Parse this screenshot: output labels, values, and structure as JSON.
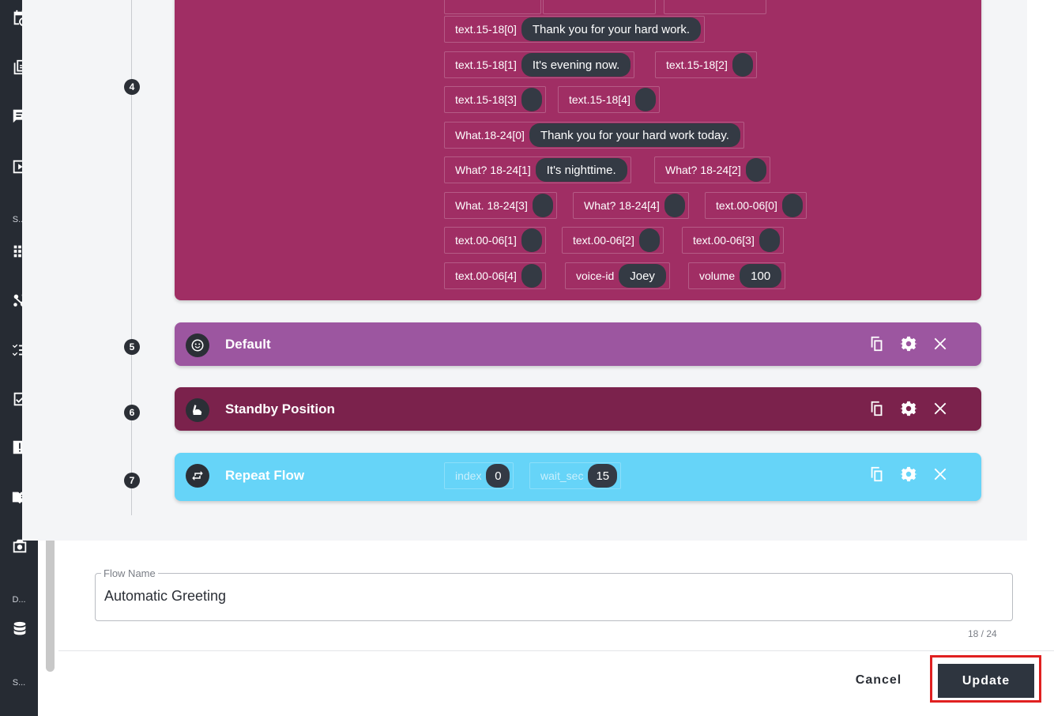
{
  "nav": {
    "label_s1": "S...",
    "label_d": "D...",
    "label_s2": "S..."
  },
  "steps": [
    "4",
    "5",
    "6",
    "7"
  ],
  "speech_block": {
    "color": "#a02e64",
    "params": [
      {
        "key": "text.15-18[0]",
        "value": "Thank you for your hard work."
      },
      {
        "key": "text.15-18[1]",
        "value": "It's evening now."
      },
      {
        "key": "text.15-18[2]",
        "value": ""
      },
      {
        "key": "text.15-18[3]",
        "value": ""
      },
      {
        "key": "text.15-18[4]",
        "value": ""
      },
      {
        "key": "What.18-24[0]",
        "value": "Thank you for your hard work today."
      },
      {
        "key": "What? 18-24[1]",
        "value": "It's nighttime."
      },
      {
        "key": "What? 18-24[2]",
        "value": ""
      },
      {
        "key": "What. 18-24[3]",
        "value": ""
      },
      {
        "key": "What? 18-24[4]",
        "value": ""
      },
      {
        "key": "text.00-06[0]",
        "value": ""
      },
      {
        "key": "text.00-06[1]",
        "value": ""
      },
      {
        "key": "text.00-06[2]",
        "value": ""
      },
      {
        "key": "text.00-06[3]",
        "value": ""
      },
      {
        "key": "text.00-06[4]",
        "value": ""
      },
      {
        "key": "voice-id",
        "value": "Joey"
      },
      {
        "key": "volume",
        "value": "100"
      }
    ]
  },
  "blocks": [
    {
      "title": "Default",
      "color": "#9c56a0",
      "icon": "smiley-icon"
    },
    {
      "title": "Standby Position",
      "color": "#7b224c",
      "icon": "arm-icon"
    },
    {
      "title": "Repeat Flow",
      "color": "#66d4f8",
      "icon": "repeat-icon",
      "params": [
        {
          "key": "index",
          "value": "0"
        },
        {
          "key": "wait_sec",
          "value": "15"
        }
      ]
    }
  ],
  "form": {
    "legend": "Flow Name",
    "value": "Automatic Greeting",
    "counter": "18 / 24"
  },
  "buttons": {
    "cancel": "Cancel",
    "update": "Update"
  }
}
